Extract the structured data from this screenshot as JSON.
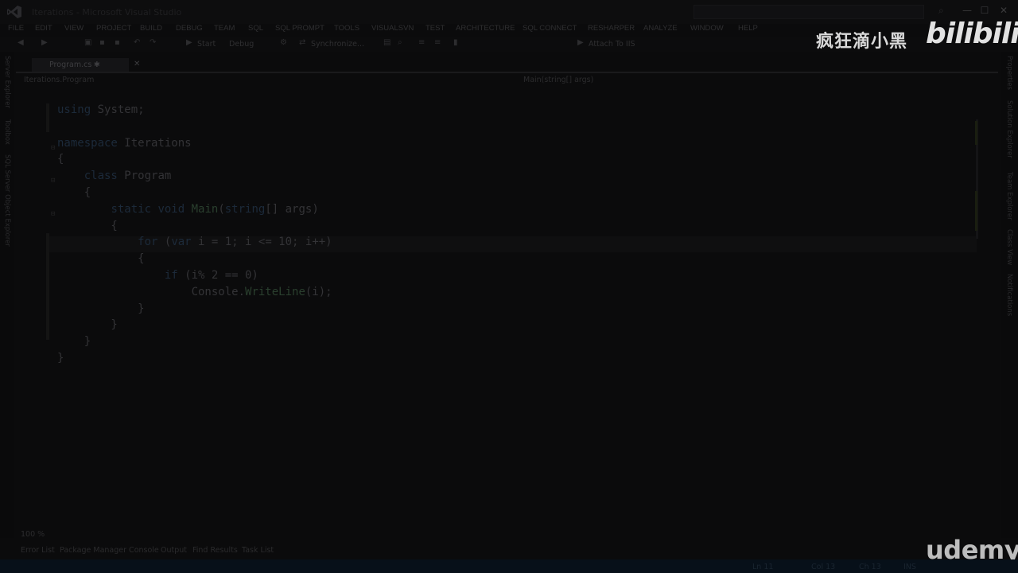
{
  "window": {
    "title": "Iterations - Microsoft Visual Studio",
    "minimize_glyph": "—",
    "maximize_glyph": "☐",
    "close_glyph": "✕",
    "search_icon": "search-icon"
  },
  "menu": [
    "FILE",
    "EDIT",
    "VIEW",
    "PROJECT",
    "BUILD",
    "DEBUG",
    "TEAM",
    "SQL",
    "SQL PROMPT",
    "TOOLS",
    "VISUALSVN",
    "TEST",
    "ARCHITECTURE",
    "SQL CONNECT",
    "RESHARPER",
    "ANALYZE",
    "WINDOW",
    "HELP"
  ],
  "toolbar": {
    "start_label": "Start",
    "config_label": "Debug",
    "sync_label": "Synchronize...",
    "attach_label": "Attach To IIS"
  },
  "watermarks": {
    "channel": "疯狂滴小黑",
    "site": "bilibili",
    "course": "udemy"
  },
  "tab": {
    "label": "Program.cs",
    "modified_mark": "✱",
    "close_glyph": "✕"
  },
  "navigation": {
    "type_path": "Iterations.Program",
    "member_path": "Main(string[] args)"
  },
  "code": [
    {
      "parts": [
        {
          "t": "using",
          "c": "kw"
        },
        {
          "t": " System;",
          "c": "id"
        }
      ]
    },
    {
      "parts": []
    },
    {
      "parts": [
        {
          "t": "namespace",
          "c": "kw"
        },
        {
          "t": " Iterations",
          "c": "id"
        }
      ]
    },
    {
      "parts": [
        {
          "t": "{",
          "c": "id"
        }
      ]
    },
    {
      "parts": [
        {
          "t": "    "
        },
        {
          "t": "class",
          "c": "kw"
        },
        {
          "t": " Program",
          "c": "id"
        }
      ]
    },
    {
      "parts": [
        {
          "t": "    {",
          "c": "id"
        }
      ]
    },
    {
      "parts": [
        {
          "t": "        "
        },
        {
          "t": "static void",
          "c": "kw"
        },
        {
          "t": " "
        },
        {
          "t": "Main",
          "c": "fn"
        },
        {
          "t": "(",
          "c": "id"
        },
        {
          "t": "string",
          "c": "kw"
        },
        {
          "t": "[] args)",
          "c": "id"
        }
      ]
    },
    {
      "parts": [
        {
          "t": "        {",
          "c": "id"
        }
      ]
    },
    {
      "parts": [
        {
          "t": "            "
        },
        {
          "t": "for",
          "c": "kw"
        },
        {
          "t": " (",
          "c": "id"
        },
        {
          "t": "var",
          "c": "kw"
        },
        {
          "t": " i = 1; i <= 10; i++)",
          "c": "id"
        }
      ]
    },
    {
      "parts": [
        {
          "t": "            {",
          "c": "id"
        }
      ]
    },
    {
      "parts": [
        {
          "t": "                "
        },
        {
          "t": "if",
          "c": "kw"
        },
        {
          "t": " (i% 2 == 0)",
          "c": "id"
        }
      ]
    },
    {
      "parts": [
        {
          "t": "                    Console.",
          "c": "id"
        },
        {
          "t": "WriteLine",
          "c": "fn"
        },
        {
          "t": "(i);",
          "c": "id"
        }
      ]
    },
    {
      "parts": [
        {
          "t": "            }",
          "c": "id"
        }
      ]
    },
    {
      "parts": [
        {
          "t": "        }",
          "c": "id"
        }
      ]
    },
    {
      "parts": [
        {
          "t": "    }",
          "c": "id"
        }
      ]
    },
    {
      "parts": [
        {
          "t": "}",
          "c": "id"
        }
      ]
    }
  ],
  "zoom": "100 %",
  "bottom_tabs": [
    "Error List",
    "Package Manager Console",
    "Output",
    "Find Results",
    "Task List"
  ],
  "status": {
    "line": "Ln 11",
    "col": "Col 13",
    "ch": "Ch 13",
    "mode": "INS"
  },
  "side_panels": {
    "left": [
      "Server Explorer",
      "Toolbox",
      "SQL Server Object Explorer"
    ],
    "right": [
      "Properties",
      "Solution Explorer",
      "Team Explorer",
      "Class View",
      "Notifications"
    ]
  }
}
